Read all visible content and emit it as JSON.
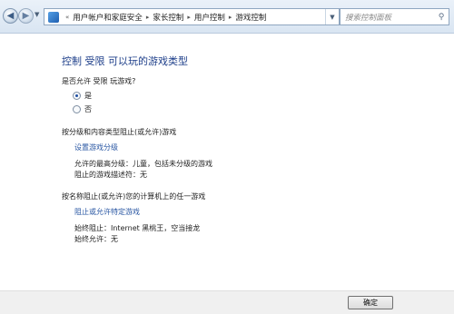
{
  "address_bar": {
    "breadcrumbs": [
      "用户帐户和家庭安全",
      "家长控制",
      "用户控制",
      "游戏控制"
    ],
    "search_placeholder": "搜索控制面板"
  },
  "page": {
    "title": "控制 受限 可以玩的游戏类型",
    "allow_question": "是否允许 受限 玩游戏?",
    "options": [
      {
        "label": "是",
        "selected": true
      },
      {
        "label": "否",
        "selected": false
      }
    ],
    "rating_section": {
      "heading": "按分级和内容类型阻止(或允许)游戏",
      "link": "设置游戏分级",
      "max_rating": "允许的最高分级：儿童，包括未分级的游戏",
      "blocked_descriptors": "阻止的游戏描述符：无"
    },
    "name_section": {
      "heading": "按名称阻止(或允许)您的计算机上的任一游戏",
      "link": "阻止或允许特定游戏",
      "always_block": "始终阻止：Internet 黑桃王，空当接龙",
      "always_allow": "始终允许：无"
    }
  },
  "footer": {
    "ok_label": "确定"
  }
}
